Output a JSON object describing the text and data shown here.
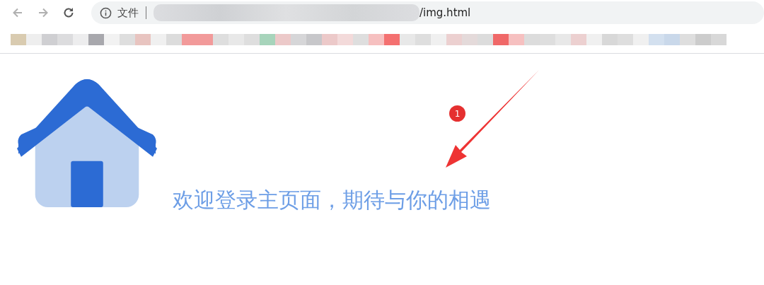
{
  "browser": {
    "security_label": "文件",
    "url_tail": "/img.html"
  },
  "page": {
    "welcome_text": "欢迎登录主页面，期待与你的相遇"
  },
  "annotation": {
    "badge": "1"
  }
}
